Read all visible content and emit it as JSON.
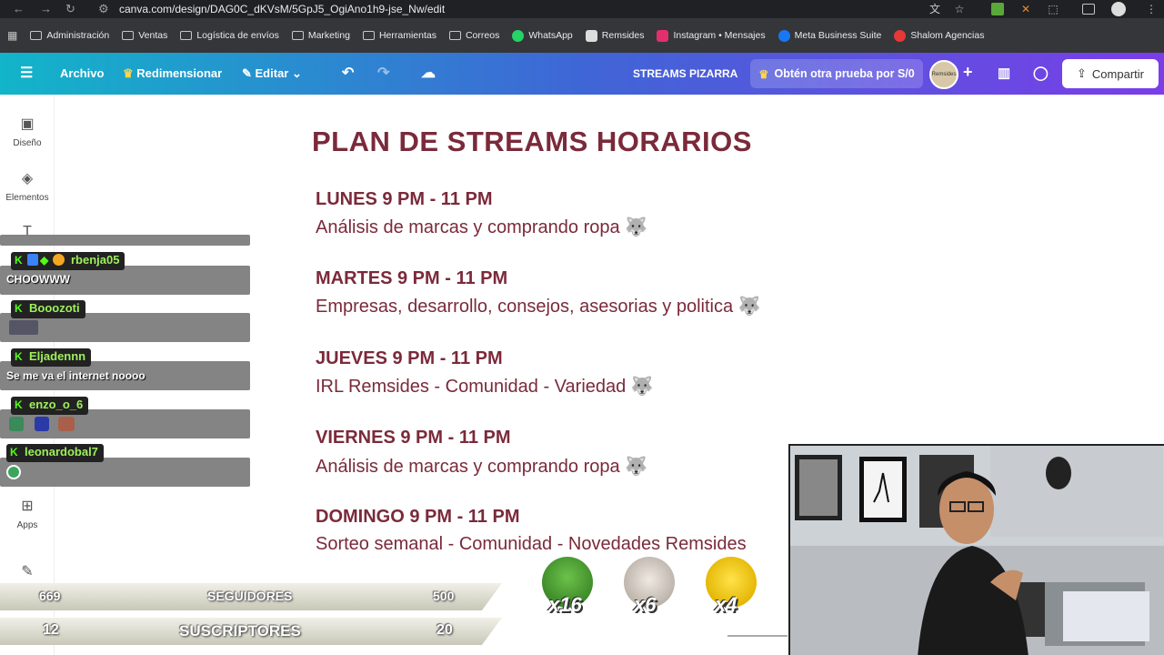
{
  "browser": {
    "url": "canva.com/design/DAG0C_dKVsM/5GpJ5_OgiAno1h9-jse_Nw/edit",
    "bookmarks": [
      {
        "label": "Administración",
        "type": "folder"
      },
      {
        "label": "Ventas",
        "type": "folder"
      },
      {
        "label": "Logística de envíos",
        "type": "folder"
      },
      {
        "label": "Marketing",
        "type": "folder"
      },
      {
        "label": "Herramientas",
        "type": "folder"
      },
      {
        "label": "Correos",
        "type": "folder"
      },
      {
        "label": "WhatsApp",
        "type": "link",
        "color": "#25d366"
      },
      {
        "label": "Remsides",
        "type": "link",
        "color": "#ddd"
      },
      {
        "label": "Instagram • Mensajes",
        "type": "link",
        "color": "#e1306c"
      },
      {
        "label": "Meta Business Suite",
        "type": "link",
        "color": "#1877f2"
      },
      {
        "label": "Shalom Agencias",
        "type": "link",
        "color": "#e53935"
      }
    ]
  },
  "canva_toolbar": {
    "file": "Archivo",
    "resize": "Redimensionar",
    "edit": "Editar",
    "doc_title": "STREAMS PIZARRA",
    "trial": "Obtén otra prueba por S/0",
    "share": "Compartir",
    "avatar_text": "Remsides"
  },
  "sidebar": [
    {
      "label": "Diseño",
      "icon": "design-icon"
    },
    {
      "label": "Elementos",
      "icon": "elements-icon"
    },
    {
      "label": "Apps",
      "icon": "apps-icon"
    }
  ],
  "document": {
    "title": "PLAN DE STREAMS HORARIOS",
    "schedule": [
      {
        "day": "LUNES 9 PM - 11 PM",
        "desc": "Análisis de marcas y comprando ropa 🐺"
      },
      {
        "day": "MARTES 9 PM - 11 PM",
        "desc": "Empresas, desarrollo, consejos, asesorias y politica 🐺"
      },
      {
        "day": "JUEVES 9 PM - 11 PM",
        "desc": "IRL Remsides - Comunidad - Variedad 🐺"
      },
      {
        "day": "VIERNES 9 PM - 11 PM",
        "desc": "Análisis de marcas y comprando ropa 🐺"
      },
      {
        "day": "DOMINGO 9 PM - 11 PM",
        "desc": "Sorteo semanal - Comunidad - Novedades Remsides"
      }
    ]
  },
  "chat": [
    {
      "user": "rbenja05",
      "message": "CHOOWWW"
    },
    {
      "user": "Booozoti",
      "message": ""
    },
    {
      "user": "Eljadennn",
      "message": "Se me va el internet noooo"
    },
    {
      "user": "enzo_o_6",
      "message": ""
    },
    {
      "user": "leonardobal7",
      "message": ""
    }
  ],
  "stats": {
    "followers": {
      "current": "669",
      "label": "SEGUIDORES",
      "goal": "500"
    },
    "subscribers": {
      "current": "12",
      "label": "SUSCRIPTORES",
      "goal": "20"
    }
  },
  "emotes": [
    {
      "name": "pepe-emote",
      "count": "x16",
      "color": "#4caf50"
    },
    {
      "name": "cat-emote",
      "count": "x6",
      "color": "#d8d0c8"
    },
    {
      "name": "bee-emote",
      "count": "x4",
      "color": "#f5d623"
    }
  ]
}
